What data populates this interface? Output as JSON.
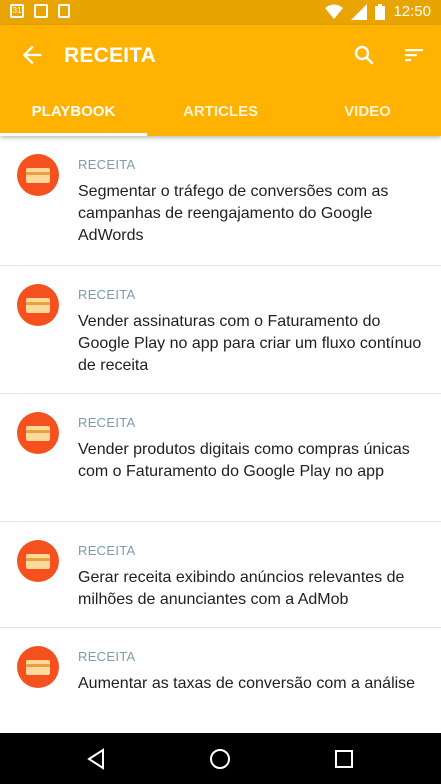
{
  "status": {
    "time": "12:50",
    "calendar_day": "31"
  },
  "appbar": {
    "title": "RECEITA"
  },
  "tabs": [
    {
      "label": "PLAYBOOK",
      "active": true
    },
    {
      "label": "ARTICLES",
      "active": false
    },
    {
      "label": "VIDEO",
      "active": false
    }
  ],
  "items": [
    {
      "category": "RECEITA",
      "text": "Segmentar o tráfego de conversões com as campanhas de reengajamento do Google AdWords"
    },
    {
      "category": "RECEITA",
      "text": "Vender assinaturas com o Faturamento do Google Play no app para criar um fluxo contínuo de receita"
    },
    {
      "category": "RECEITA",
      "text": "Vender produtos digitais como compras únicas com o Faturamento do Google Play no app"
    },
    {
      "category": "RECEITA",
      "text": "Gerar receita exibindo anúncios relevantes de milhões de anunciantes com a AdMob"
    },
    {
      "category": "RECEITA",
      "text": "Aumentar as taxas de conversão com a análise"
    }
  ],
  "colors": {
    "appbar": "#FFB300",
    "statusbar": "#E8A400",
    "avatar": "#F4511E"
  },
  "icons": [
    "back-arrow-icon",
    "search-icon",
    "sort-icon",
    "credit-card-icon",
    "nav-back-icon",
    "nav-home-icon",
    "nav-recents-icon"
  ]
}
